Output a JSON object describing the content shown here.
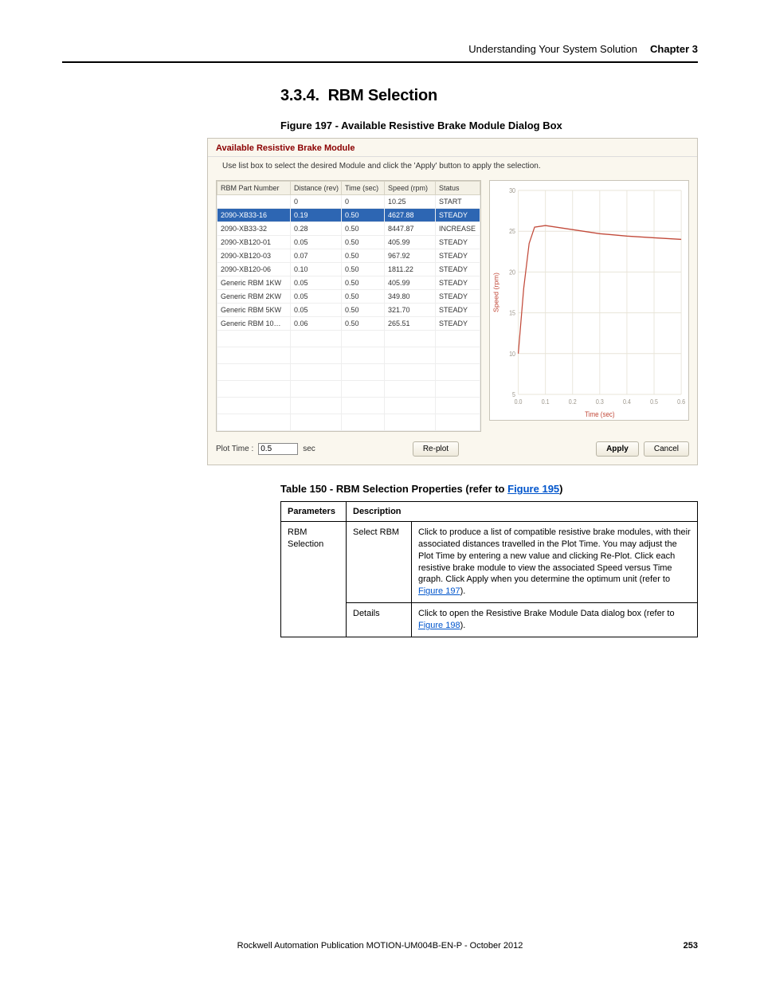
{
  "header": {
    "title": "Understanding Your System Solution",
    "chapter": "Chapter 3"
  },
  "section": {
    "number": "3.3.4.",
    "title": "RBM Selection"
  },
  "figure_caption": "Figure 197 - Available Resistive Brake Module Dialog Box",
  "dialog": {
    "title": "Available Resistive Brake Module",
    "instruction": "Use list box to select the desired Module and click the 'Apply' button to apply the selection.",
    "columns": [
      "RBM Part Number",
      "Distance (rev)",
      "Time (sec)",
      "Speed (rpm)",
      "Status"
    ],
    "rows": [
      {
        "pn": "",
        "dist": "0",
        "time": "0",
        "speed": "10.25",
        "status": "START",
        "sel": false
      },
      {
        "pn": "2090-XB33-16",
        "dist": "0.19",
        "time": "0.50",
        "speed": "4627.88",
        "status": "STEADY",
        "sel": true
      },
      {
        "pn": "2090-XB33-32",
        "dist": "0.28",
        "time": "0.50",
        "speed": "8447.87",
        "status": "INCREASE",
        "sel": false
      },
      {
        "pn": "2090-XB120-01",
        "dist": "0.05",
        "time": "0.50",
        "speed": "405.99",
        "status": "STEADY",
        "sel": false
      },
      {
        "pn": "2090-XB120-03",
        "dist": "0.07",
        "time": "0.50",
        "speed": "967.92",
        "status": "STEADY",
        "sel": false
      },
      {
        "pn": "2090-XB120-06",
        "dist": "0.10",
        "time": "0.50",
        "speed": "1811.22",
        "status": "STEADY",
        "sel": false
      },
      {
        "pn": "Generic RBM 1KW",
        "dist": "0.05",
        "time": "0.50",
        "speed": "405.99",
        "status": "STEADY",
        "sel": false
      },
      {
        "pn": "Generic RBM 2KW",
        "dist": "0.05",
        "time": "0.50",
        "speed": "349.80",
        "status": "STEADY",
        "sel": false
      },
      {
        "pn": "Generic RBM 5KW",
        "dist": "0.05",
        "time": "0.50",
        "speed": "321.70",
        "status": "STEADY",
        "sel": false
      },
      {
        "pn": "Generic RBM 10…",
        "dist": "0.06",
        "time": "0.50",
        "speed": "265.51",
        "status": "STEADY",
        "sel": false
      }
    ],
    "plot_time_label": "Plot Time :",
    "plot_time_value": "0.5",
    "plot_time_unit": "sec",
    "replot": "Re-plot",
    "apply": "Apply",
    "cancel": "Cancel"
  },
  "chart_data": {
    "type": "line",
    "title": "",
    "xlabel": "Time (sec)",
    "ylabel": "Speed (rpm)",
    "xlim": [
      0.0,
      0.6
    ],
    "ylim": [
      5,
      30
    ],
    "x_ticks": [
      0.0,
      0.1,
      0.2,
      0.3,
      0.4,
      0.5,
      0.6
    ],
    "y_ticks": [
      5,
      10,
      15,
      20,
      25,
      30
    ],
    "series": [
      {
        "name": "Speed",
        "x": [
          0.0,
          0.02,
          0.04,
          0.06,
          0.1,
          0.2,
          0.3,
          0.4,
          0.5,
          0.55,
          0.6
        ],
        "y": [
          10.0,
          18.0,
          23.5,
          25.5,
          25.7,
          25.2,
          24.7,
          24.4,
          24.2,
          24.1,
          24.0
        ]
      }
    ]
  },
  "table_caption_prefix": "Table 150 - RBM Selection Properties (refer to ",
  "table_caption_link": "Figure 195",
  "table_caption_suffix": ")",
  "prop_headers": [
    "Parameters",
    "Description"
  ],
  "prop_rows": {
    "group": "RBM Selection",
    "r1_param": "Select RBM",
    "r1_desc_a": "Click to produce a list of compatible resistive brake modules, with their associated distances travelled in the Plot Time. You may adjust the Plot Time by entering a new value and clicking Re-Plot. Click each resistive brake module to view the associated Speed versus Time graph. Click Apply when you determine the optimum unit (refer to ",
    "r1_desc_link": "Figure 197",
    "r1_desc_b": ").",
    "r2_param": "Details",
    "r2_desc_a": "Click to open the Resistive Brake Module Data dialog box (refer to ",
    "r2_desc_link": "Figure 198",
    "r2_desc_b": ")."
  },
  "footer": {
    "pub": "Rockwell Automation Publication MOTION-UM004B-EN-P - October 2012",
    "page": "253"
  }
}
